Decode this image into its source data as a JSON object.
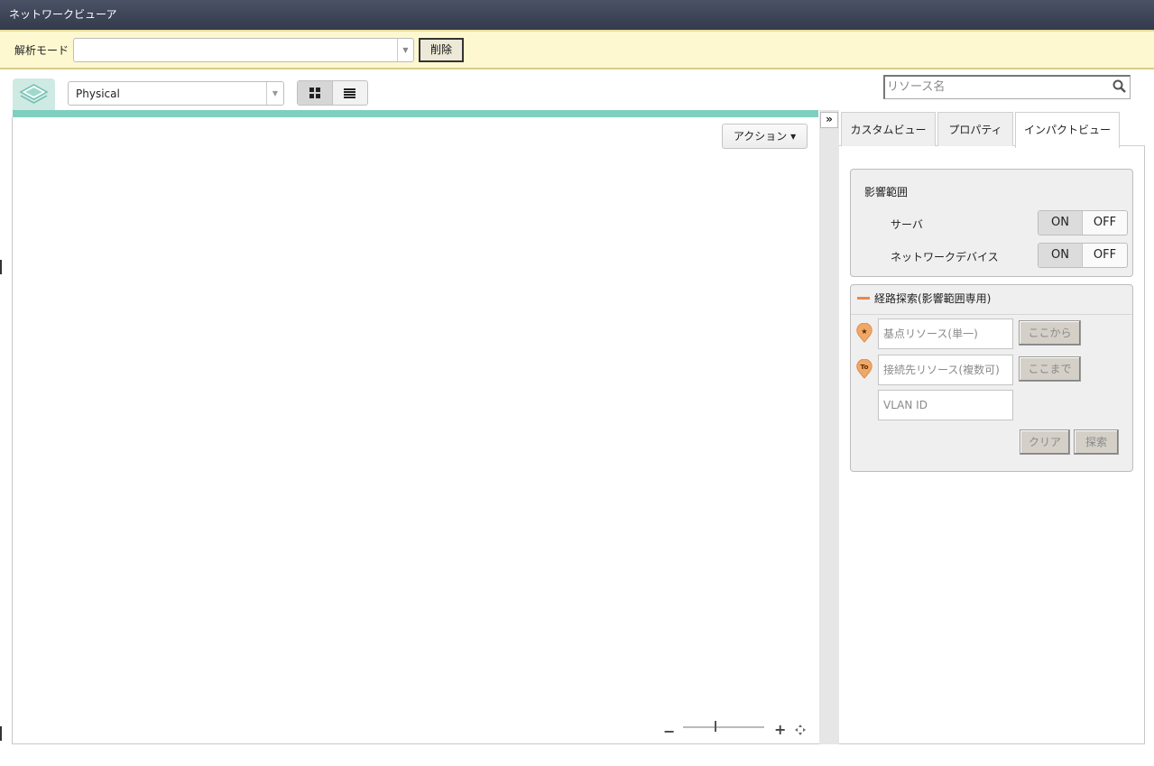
{
  "app": {
    "title": "ネットワークビューア"
  },
  "modebar": {
    "label": "解析モード",
    "select_value": "",
    "delete_label": "削除"
  },
  "toolbar": {
    "layer_select": "Physical",
    "search_placeholder": "リソース名"
  },
  "canvas": {
    "action_label": "アクション ▾"
  },
  "zoom": {
    "minus": "−",
    "plus": "+",
    "level_percent": 40
  },
  "splitter": {
    "collapse_label": "»"
  },
  "tabs": [
    {
      "label": "カスタムビュー",
      "active": false
    },
    {
      "label": "プロパティ",
      "active": false
    },
    {
      "label": "インパクトビュー",
      "active": true
    }
  ],
  "impact": {
    "title": "影響範囲",
    "rows": [
      {
        "label": "サーバ",
        "on": "ON",
        "off": "OFF",
        "state": "ON"
      },
      {
        "label": "ネットワークデバイス",
        "on": "ON",
        "off": "OFF",
        "state": "ON"
      }
    ]
  },
  "route": {
    "title": "経路探索(影響範囲専用)",
    "origin_placeholder": "基点リソース(単一)",
    "origin_button": "ここから",
    "origin_pin": "★",
    "dest_placeholder": "接続先リソース(複数可)",
    "dest_button": "ここまで",
    "dest_pin": "To",
    "vlan_placeholder": "VLAN ID",
    "clear_button": "クリア",
    "search_button": "探索"
  },
  "colors": {
    "accent_teal": "#7fcfc1",
    "pin_orange": "#f0a868",
    "modebar_bg": "#fdf8d0"
  }
}
